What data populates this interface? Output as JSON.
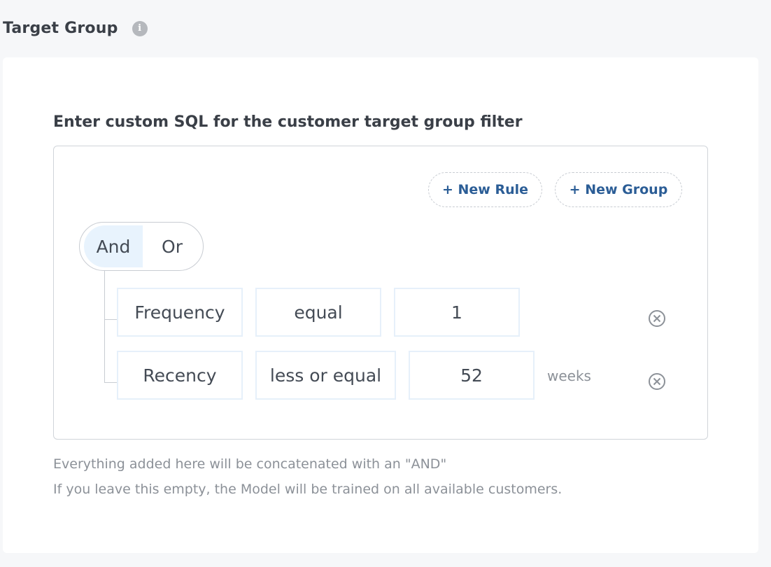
{
  "section": {
    "title": "Target Group",
    "info_icon": "i"
  },
  "filter": {
    "label": "Enter custom SQL for the customer target group filter",
    "buttons": {
      "new_rule": "+ New Rule",
      "new_group": "+ New Group"
    },
    "combinator": {
      "options": [
        "And",
        "Or"
      ],
      "selected": "And"
    },
    "rules": [
      {
        "field": "Frequency",
        "operator": "equal",
        "value": "1",
        "unit": ""
      },
      {
        "field": "Recency",
        "operator": "less or equal",
        "value": "52",
        "unit": "weeks"
      }
    ],
    "help_lines": [
      "Everything added here will be concatenated with an \"AND\"",
      "If you leave this empty, the Model will be trained on all available customers."
    ]
  },
  "colors": {
    "accent": "#2b5d96",
    "selected_bg": "#e8f3fd",
    "field_border": "#e6f0fa",
    "muted_text": "#8c9198"
  }
}
